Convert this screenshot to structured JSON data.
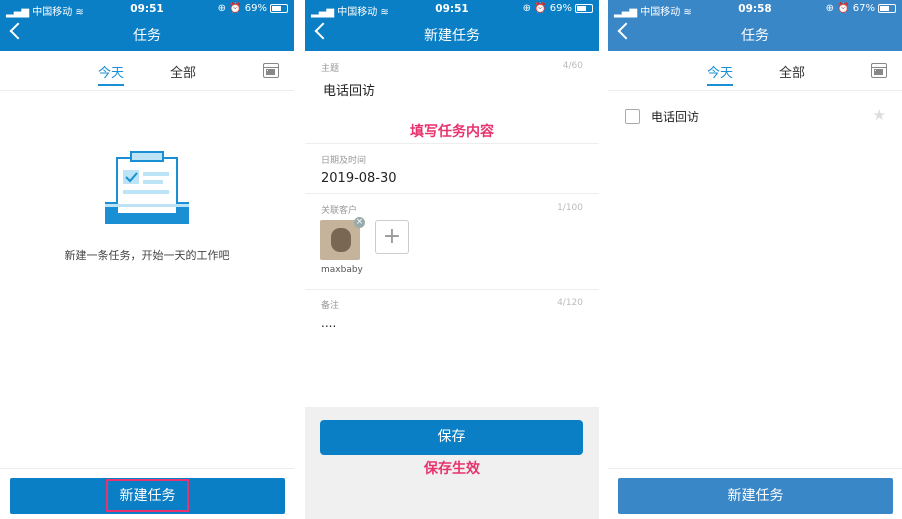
{
  "colors": {
    "primary": "#0a7fc5",
    "primary_alt": "#3a87c8",
    "accent": "#1a8fd3",
    "annotation": "#e8336e"
  },
  "panel1": {
    "status": {
      "carrier": "中国移动",
      "time": "09:51",
      "battery": "69%"
    },
    "title": "任务",
    "tabs": [
      "今天",
      "全部"
    ],
    "empty_text": "新建一条任务，开始一天的工作吧",
    "new_task_button": "新建任务"
  },
  "panel2": {
    "status": {
      "carrier": "中国移动",
      "time": "09:51",
      "battery": "69%"
    },
    "title": "新建任务",
    "subject": {
      "label": "主题",
      "count": "4/60",
      "value": "电话回访"
    },
    "annotation_fill": "填写任务内容",
    "datetime": {
      "label": "日期及时间",
      "value": "2019-08-30"
    },
    "customer": {
      "label": "关联客户",
      "count": "1/100",
      "name": "maxbaby",
      "add_symbol": "+"
    },
    "remark": {
      "label": "备注",
      "count": "4/120",
      "value": "...."
    },
    "save_button": "保存",
    "annotation_save": "保存生效"
  },
  "panel3": {
    "status": {
      "carrier": "中国移动",
      "time": "09:58",
      "battery": "67%"
    },
    "title": "任务",
    "tabs": [
      "今天",
      "全部"
    ],
    "task_item": "电话回访",
    "new_task_button": "新建任务"
  }
}
